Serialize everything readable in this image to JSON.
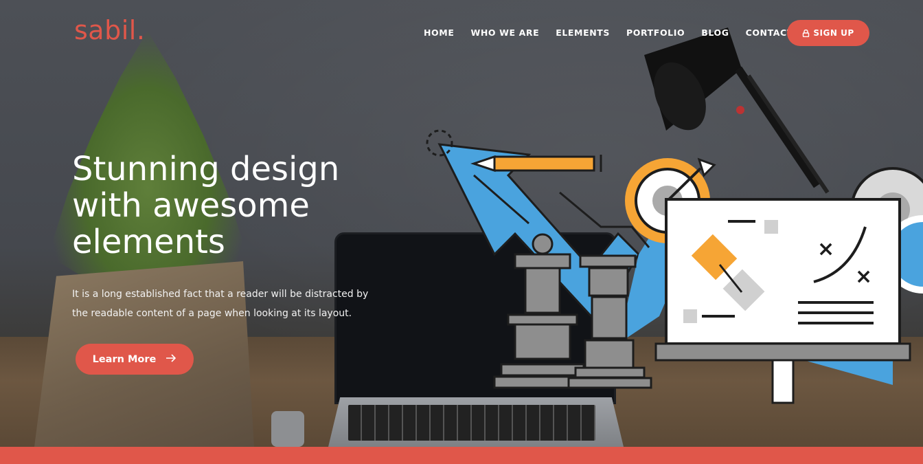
{
  "brand": {
    "logo": "sabil.",
    "accent": "#e0574a"
  },
  "nav": {
    "items": [
      "HOME",
      "WHO WE ARE",
      "ELEMENTS",
      "PORTFOLIO",
      "BLOG",
      "CONTACT"
    ],
    "signup_label": "SIGN UP",
    "signup_icon": "lock-icon"
  },
  "hero": {
    "headline_lines": [
      "Stunning design",
      "with awesome",
      "elements"
    ],
    "description_lines": [
      "It is a long established fact that a reader will be distracted by",
      "the readable content of a page when looking at its layout."
    ],
    "cta_label": "Learn More",
    "cta_icon": "arrow-right-icon"
  },
  "illustration": {
    "icons": [
      "chess-king-icon",
      "chess-rook-icon",
      "target-icon",
      "pencil-icon",
      "monitor-strategy-icon",
      "gear-icon",
      "growth-arrow-icon"
    ],
    "colors": {
      "blue": "#4aa3de",
      "orange": "#f6a535",
      "gray": "#8e8e8e",
      "dark": "#1d1d1d"
    }
  }
}
